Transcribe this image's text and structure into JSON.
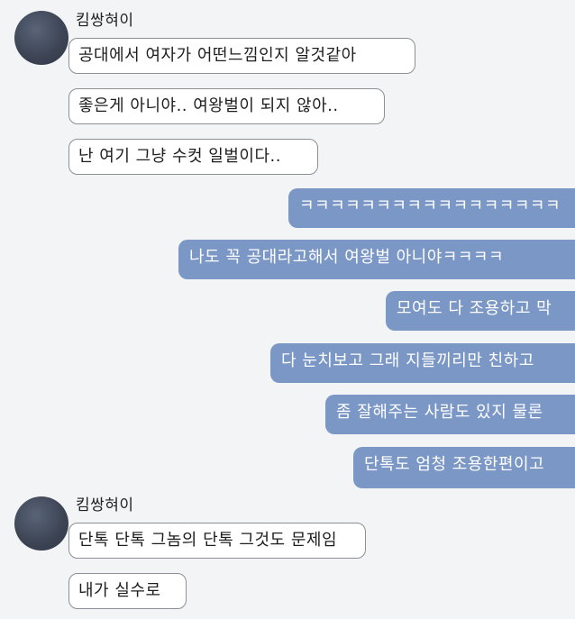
{
  "thread": [
    {
      "sender": "킴쌍혀이",
      "messages": [
        "공대에서 여자가 어떤느낌인지 알것같아",
        "좋은게 아니야.. 여왕벌이 되지 않아..",
        "난 여기 그냥 수컷 일벌이다.."
      ]
    },
    {
      "sender": "me",
      "messages": [
        "ㅋㅋㅋㅋㅋㅋㅋㅋㅋㅋㅋㅋㅋㅋㅋㅋㅋ",
        "나도 꼭 공대라고해서 여왕벌 아니야ㅋㅋㅋㅋ",
        "모여도 다 조용하고 막",
        "다 눈치보고 그래 지들끼리만 친하고",
        "좀 잘해주는 사람도 있지 물론",
        "단톡도 엄청 조용한편이고"
      ]
    },
    {
      "sender": "킴쌍혀이",
      "messages": [
        "단톡 단톡 그놈의 단톡 그것도 문제임",
        "내가 실수로"
      ]
    }
  ],
  "colors": {
    "background": "#f3f4f6",
    "incoming_bubble": "#ffffff",
    "incoming_border": "#8c8f94",
    "outgoing_bubble": "#7b97c6",
    "outgoing_text": "#ffffff",
    "avatar": "#3e4656"
  }
}
